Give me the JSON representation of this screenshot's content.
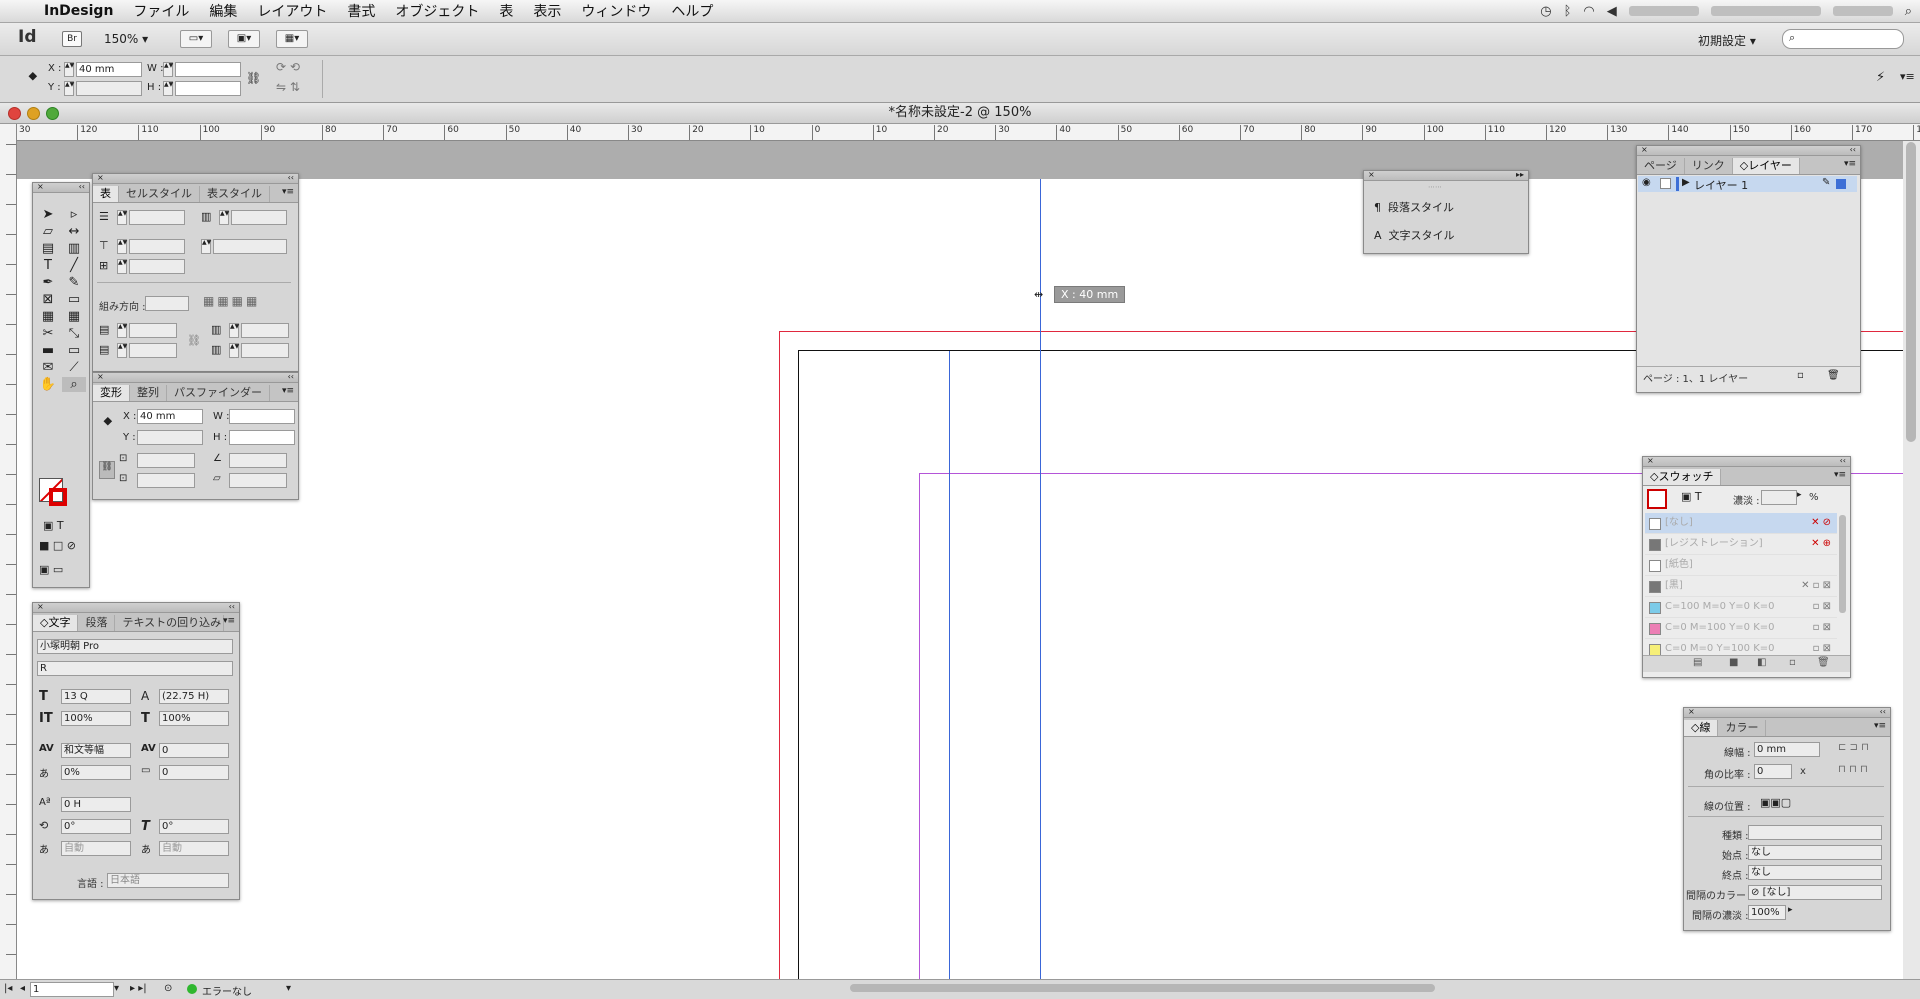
{
  "menubar": {
    "apple": "",
    "app": "InDesign",
    "items": [
      "ファイル",
      "編集",
      "レイアウト",
      "書式",
      "オブジェクト",
      "表",
      "表示",
      "ウィンドウ",
      "ヘルプ"
    ]
  },
  "appbar": {
    "logo": "Id",
    "bridge": "Br",
    "zoom": "150%",
    "preset": "初期設定",
    "colors": {
      "accent": "#3d7fe0"
    }
  },
  "control": {
    "x_label": "X :",
    "x_value": "40 mm",
    "y_label": "Y :",
    "w_label": "W :",
    "h_label": "H :"
  },
  "document": {
    "title": "*名称未設定-2 @ 150%",
    "ruler_h": [
      "30",
      "120",
      "110",
      "100",
      "90",
      "80",
      "70",
      "60",
      "50",
      "40",
      "30",
      "20",
      "10",
      "0",
      "10",
      "20",
      "30",
      "40",
      "50",
      "60",
      "70",
      "80",
      "90",
      "100",
      "110",
      "120",
      "130",
      "140",
      "150",
      "160",
      "170",
      "18"
    ],
    "cursor_tip": "X : 40 mm",
    "colors": {
      "margin": "#e0283e",
      "guide": "#3a66d8",
      "bleed": "#b455d8",
      "page": "#111111"
    }
  },
  "status": {
    "page": "1",
    "errors": "エラーなし"
  },
  "table_panel": {
    "tabs": [
      "表",
      "セルスタイル",
      "表スタイル"
    ],
    "direction_label": "組み方向 :"
  },
  "transform_panel": {
    "tabs": [
      "変形",
      "整列",
      "パスファインダー"
    ],
    "x_label": "X :",
    "x_value": "40 mm",
    "y_label": "Y :",
    "w_label": "W :",
    "h_label": "H :"
  },
  "char_panel": {
    "tabs": [
      "文字",
      "段落",
      "テキストの回り込み"
    ],
    "font": "小塚明朝 Pro",
    "style": "R",
    "size": "13 Q",
    "leading": "(22.75 H)",
    "vscale": "100%",
    "hscale": "100%",
    "kerning": "和文等幅",
    "tracking": "0",
    "tsume": "0%",
    "grid": "0",
    "baseline": "0 H",
    "rotate": "0°",
    "skew": "0°",
    "auto1": "自動",
    "auto2": "自動",
    "lang_label": "言語 :",
    "lang": "日本語"
  },
  "style_panel": {
    "items": [
      "段落スタイル",
      "文字スタイル"
    ]
  },
  "layers_panel": {
    "tabs": [
      "ページ",
      "リンク",
      "レイヤー"
    ],
    "layer": "レイヤー 1",
    "footer": "ページ : 1、1 レイヤー",
    "layer_color": "#3d6fd6"
  },
  "swatch_panel": {
    "title": "スウォッチ",
    "tint_label": "濃淡 :",
    "tint_unit": "%",
    "items": [
      {
        "name": "[なし]",
        "color": "#ffffff"
      },
      {
        "name": "[レジストレーション]",
        "color": "#222222"
      },
      {
        "name": "[紙色]",
        "color": "#ffffff"
      },
      {
        "name": "[黒]",
        "color": "#222222"
      },
      {
        "name": "C=100 M=0 Y=0 K=0",
        "color": "#3fb5e5"
      },
      {
        "name": "C=0 M=100 Y=0 K=0",
        "color": "#e6388e"
      },
      {
        "name": "C=0 M=0 Y=100 K=0",
        "color": "#f6ec3c"
      }
    ]
  },
  "stroke_panel": {
    "tabs": [
      "線",
      "カラー"
    ],
    "width_label": "線幅 :",
    "width": "0 mm",
    "miter_label": "角の比率 :",
    "miter": "0",
    "miter_unit": "x",
    "align_label": "線の位置 :",
    "type_label": "種類 :",
    "start_label": "始点 :",
    "start": "なし",
    "end_label": "終点 :",
    "end": "なし",
    "gapcolor_label": "間隔のカラー :",
    "gapcolor": "[なし]",
    "gaptint_label": "間隔の濃淡 :",
    "gaptint": "100%"
  }
}
